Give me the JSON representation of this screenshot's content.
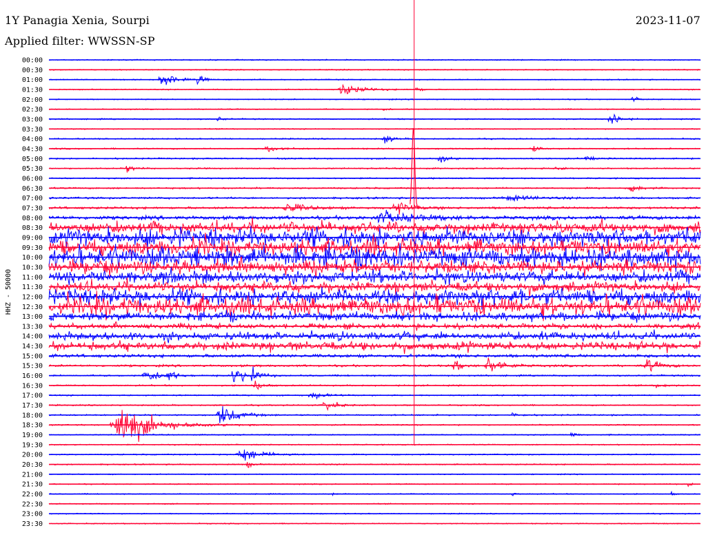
{
  "header": {
    "station": "1Y Panagia Xenia, Sourpi",
    "date": "2023-11-07",
    "filter": "Applied filter: WWSSN-SP"
  },
  "chart_data": {
    "type": "line",
    "title": "1Y Panagia Xenia, Sourpi",
    "date": "2023-11-07",
    "subtitle": "Applied filter: WWSSN-SP",
    "ylabel": "HHZ - 50000",
    "xlabel": "",
    "colors": {
      "even_trace": "#0000ff",
      "odd_trace": "#ff0033",
      "vertical_marker": "#ff0033"
    },
    "rows": [
      {
        "label": "00:00",
        "noise": 1.0,
        "color": "blue"
      },
      {
        "label": "00:30",
        "noise": 1.0,
        "color": "red"
      },
      {
        "label": "01:00",
        "noise": 1.0,
        "color": "blue",
        "events": [
          {
            "x": 0.17,
            "amp": 14,
            "w": 0.018
          },
          {
            "x": 0.228,
            "amp": 14,
            "w": 0.01
          }
        ]
      },
      {
        "label": "01:30",
        "noise": 1.0,
        "color": "red",
        "events": [
          {
            "x": 0.445,
            "amp": 9,
            "w": 0.03
          },
          {
            "x": 0.562,
            "amp": 5,
            "w": 0.008
          }
        ]
      },
      {
        "label": "02:00",
        "noise": 1.0,
        "color": "blue",
        "events": [
          {
            "x": 0.894,
            "amp": 5,
            "w": 0.008
          }
        ]
      },
      {
        "label": "02:30",
        "noise": 1.0,
        "color": "red",
        "events": [
          {
            "x": 0.51,
            "amp": 3,
            "w": 0.008
          }
        ]
      },
      {
        "label": "03:00",
        "noise": 1.2,
        "color": "blue",
        "events": [
          {
            "x": 0.86,
            "amp": 14,
            "w": 0.012
          },
          {
            "x": 0.258,
            "amp": 4,
            "w": 0.008
          }
        ]
      },
      {
        "label": "03:30",
        "noise": 1.0,
        "color": "red"
      },
      {
        "label": "04:00",
        "noise": 1.2,
        "color": "blue",
        "events": [
          {
            "x": 0.513,
            "amp": 7,
            "w": 0.012
          }
        ]
      },
      {
        "label": "04:30",
        "noise": 1.3,
        "color": "red",
        "events": [
          {
            "x": 0.33,
            "amp": 5,
            "w": 0.02
          },
          {
            "x": 0.74,
            "amp": 5,
            "w": 0.012
          }
        ]
      },
      {
        "label": "05:00",
        "noise": 1.4,
        "color": "blue",
        "events": [
          {
            "x": 0.598,
            "amp": 8,
            "w": 0.01
          },
          {
            "x": 0.823,
            "amp": 6,
            "w": 0.008
          }
        ]
      },
      {
        "label": "05:30",
        "noise": 1.3,
        "color": "red",
        "events": [
          {
            "x": 0.118,
            "amp": 6,
            "w": 0.01
          },
          {
            "x": 0.775,
            "amp": 5,
            "w": 0.01
          }
        ]
      },
      {
        "label": "06:00",
        "noise": 1.3,
        "color": "blue"
      },
      {
        "label": "06:30",
        "noise": 1.5,
        "color": "red",
        "events": [
          {
            "x": 0.892,
            "amp": 5,
            "w": 0.015
          }
        ]
      },
      {
        "label": "07:00",
        "noise": 1.8,
        "color": "blue",
        "events": [
          {
            "x": 0.7,
            "amp": 4,
            "w": 0.04
          }
        ]
      },
      {
        "label": "07:30",
        "noise": 2.2,
        "color": "red",
        "events": [
          {
            "x": 0.36,
            "amp": 8,
            "w": 0.03
          },
          {
            "x": 0.53,
            "amp": 12,
            "w": 0.02
          }
        ]
      },
      {
        "label": "08:00",
        "noise": 3.5,
        "color": "blue",
        "events": [
          {
            "x": 0.5,
            "amp": 8,
            "w": 0.06
          }
        ]
      },
      {
        "label": "08:30",
        "noise": 13,
        "color": "red"
      },
      {
        "label": "09:00",
        "noise": 20,
        "color": "blue"
      },
      {
        "label": "09:30",
        "noise": 18,
        "color": "red"
      },
      {
        "label": "10:00",
        "noise": 22,
        "color": "blue"
      },
      {
        "label": "10:30",
        "noise": 15,
        "color": "red"
      },
      {
        "label": "11:00",
        "noise": 14,
        "color": "blue"
      },
      {
        "label": "11:30",
        "noise": 12,
        "color": "red"
      },
      {
        "label": "12:00",
        "noise": 18,
        "color": "blue"
      },
      {
        "label": "12:30",
        "noise": 20,
        "color": "red"
      },
      {
        "label": "13:00",
        "noise": 10,
        "color": "blue"
      },
      {
        "label": "13:30",
        "noise": 6,
        "color": "red"
      },
      {
        "label": "14:00",
        "noise": 9,
        "color": "blue"
      },
      {
        "label": "14:30",
        "noise": 10,
        "color": "red"
      },
      {
        "label": "15:00",
        "noise": 3,
        "color": "blue"
      },
      {
        "label": "15:30",
        "noise": 2,
        "color": "red",
        "events": [
          {
            "x": 0.62,
            "amp": 10,
            "w": 0.01
          },
          {
            "x": 0.67,
            "amp": 12,
            "w": 0.025
          },
          {
            "x": 0.915,
            "amp": 9,
            "w": 0.02
          }
        ]
      },
      {
        "label": "16:00",
        "noise": 1.5,
        "color": "blue",
        "events": [
          {
            "x": 0.145,
            "amp": 12,
            "w": 0.02
          },
          {
            "x": 0.18,
            "amp": 10,
            "w": 0.01
          },
          {
            "x": 0.28,
            "amp": 14,
            "w": 0.02
          },
          {
            "x": 0.31,
            "amp": 12,
            "w": 0.01
          }
        ]
      },
      {
        "label": "16:30",
        "noise": 1.4,
        "color": "red",
        "events": [
          {
            "x": 0.315,
            "amp": 10,
            "w": 0.01
          },
          {
            "x": 0.93,
            "amp": 3,
            "w": 0.015
          }
        ]
      },
      {
        "label": "17:00",
        "noise": 1.3,
        "color": "blue",
        "events": [
          {
            "x": 0.4,
            "amp": 5,
            "w": 0.02
          }
        ]
      },
      {
        "label": "17:30",
        "noise": 1.3,
        "color": "red",
        "events": [
          {
            "x": 0.42,
            "amp": 12,
            "w": 0.015
          }
        ]
      },
      {
        "label": "18:00",
        "noise": 1.4,
        "color": "blue",
        "events": [
          {
            "x": 0.26,
            "amp": 16,
            "w": 0.025
          },
          {
            "x": 0.71,
            "amp": 3,
            "w": 0.012
          }
        ]
      },
      {
        "label": "18:30",
        "noise": 1.2,
        "color": "red",
        "events": [
          {
            "x": 0.1,
            "amp": 34,
            "w": 0.05
          }
        ]
      },
      {
        "label": "19:00",
        "noise": 1.1,
        "color": "blue",
        "events": [
          {
            "x": 0.8,
            "amp": 5,
            "w": 0.008
          }
        ]
      },
      {
        "label": "19:30",
        "noise": 1.1,
        "color": "red"
      },
      {
        "label": "20:00",
        "noise": 1.2,
        "color": "blue",
        "events": [
          {
            "x": 0.29,
            "amp": 10,
            "w": 0.035
          }
        ]
      },
      {
        "label": "20:30",
        "noise": 1.2,
        "color": "red",
        "events": [
          {
            "x": 0.303,
            "amp": 5,
            "w": 0.008
          }
        ]
      },
      {
        "label": "21:00",
        "noise": 1.0,
        "color": "blue"
      },
      {
        "label": "21:30",
        "noise": 1.0,
        "color": "red",
        "events": [
          {
            "x": 0.98,
            "amp": 5,
            "w": 0.006
          }
        ]
      },
      {
        "label": "22:00",
        "noise": 1.0,
        "color": "blue",
        "events": [
          {
            "x": 0.435,
            "amp": 3,
            "w": 0.004
          },
          {
            "x": 0.71,
            "amp": 5,
            "w": 0.004
          },
          {
            "x": 0.955,
            "amp": 3,
            "w": 0.004
          }
        ]
      },
      {
        "label": "22:30",
        "noise": 1.0,
        "color": "red"
      },
      {
        "label": "23:00",
        "noise": 1.0,
        "color": "blue"
      },
      {
        "label": "23:30",
        "noise": 1.0,
        "color": "red"
      }
    ]
  }
}
